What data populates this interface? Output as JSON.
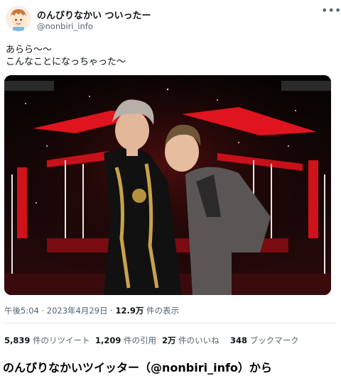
{
  "tweet": {
    "display_name": "のんびりなかい ついったー",
    "handle": "@nonbiri_info",
    "text_lines": [
      "あらら〜〜",
      "こんなことになっちゃった〜"
    ],
    "time": "午後5:04 · 2023年4月29日 · ",
    "views_count": "12.9万",
    "views_label": " 件の表示",
    "more_icon": "•••"
  },
  "stats": {
    "retweets_count": "5,839",
    "retweets_label": " 件のリツイート",
    "quotes_count": "1,209",
    "quotes_label": " 件の引用",
    "likes_count": "2万",
    "likes_label": " 件のいいね",
    "bookmarks_count": "348",
    "bookmarks_label": " ブックマーク"
  },
  "caption": "のんびりなかいツイッター（@nonbiri_info）から",
  "colors": {
    "secondary_text": "#536471",
    "stage_red": "#e0141e",
    "divider": "#e6ecf0"
  }
}
